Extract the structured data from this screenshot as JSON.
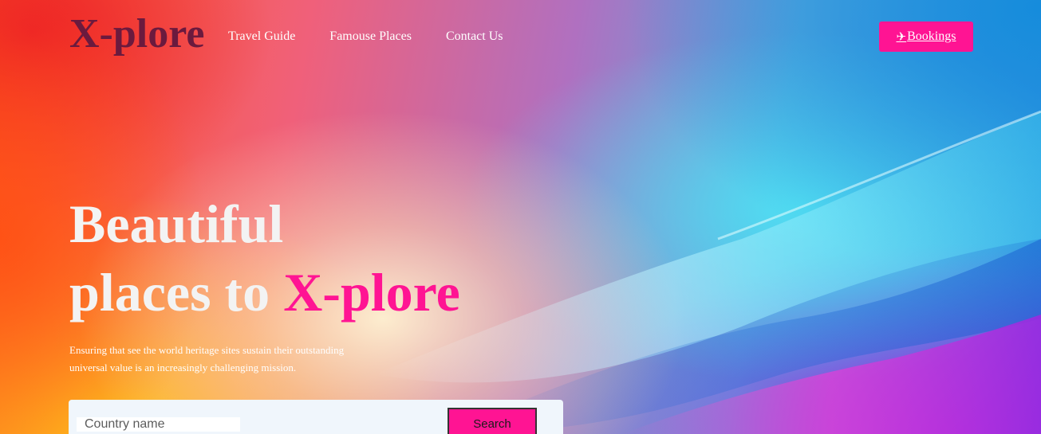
{
  "header": {
    "logo": "X-plore",
    "nav": [
      {
        "label": "Travel Guide"
      },
      {
        "label": "Famouse Places"
      },
      {
        "label": "Contact Us"
      }
    ],
    "bookings_label": "Bookings",
    "bookings_icon": "airplane-icon"
  },
  "hero": {
    "headline_line1": "Beautiful",
    "headline_line2_prefix": "places to ",
    "headline_accent": "X-plore",
    "tagline": "Ensuring that see the world heritage sites sustain their outstanding universal value is an increasingly challenging mission."
  },
  "search": {
    "placeholder": "Country name",
    "value": "",
    "button_label": "Search"
  },
  "colors": {
    "accent": "#ff1493",
    "logo": "#6b1a3e",
    "search_panel": "#f0f6fc"
  }
}
